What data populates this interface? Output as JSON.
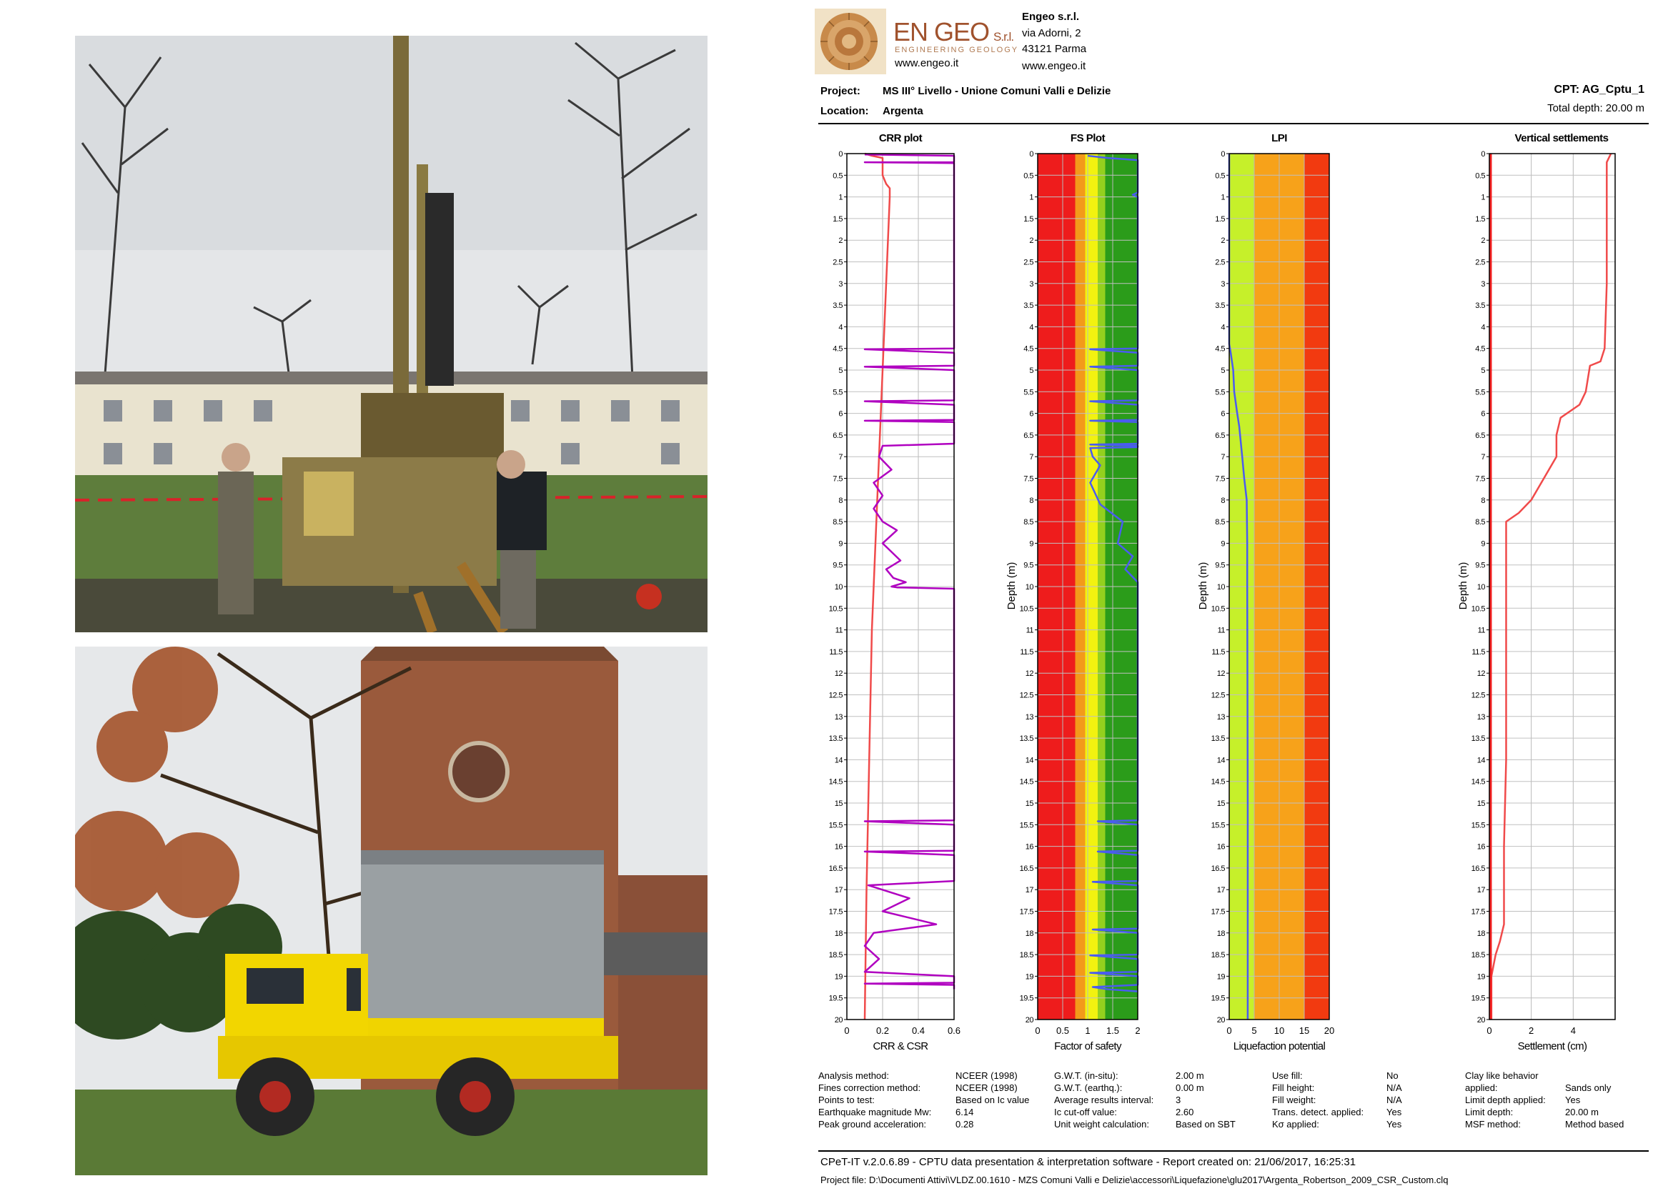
{
  "report": {
    "company": {
      "logo_main": "EN GEO",
      "logo_suffix": "S.r.l.",
      "logo_tagline": "ENGINEERING GEOLOGY",
      "logo_web": "www.engeo.it",
      "name": "Engeo s.r.l.",
      "address1": "via Adorni, 2",
      "address2": "43121 Parma",
      "web": "www.engeo.it"
    },
    "project_label": "Project:",
    "project_value": "MS III° Livello - Unione Comuni Valli e Delizie",
    "location_label": "Location:",
    "location_value": "Argenta",
    "cpt_label": "CPT: AG_Cptu_1",
    "total_depth": "Total depth: 20.00 m",
    "summary": {
      "col1": [
        [
          "Analysis method:",
          "NCEER (1998)"
        ],
        [
          "Fines correction method:",
          "NCEER (1998)"
        ],
        [
          "Points to test:",
          "Based on Ic value"
        ],
        [
          "Earthquake magnitude Mw:",
          "6.14"
        ],
        [
          "Peak ground acceleration:",
          "0.28"
        ]
      ],
      "col2": [
        [
          "G.W.T. (in-situ):",
          "2.00 m"
        ],
        [
          "G.W.T. (earthq.):",
          "0.00 m"
        ],
        [
          "Average results interval:",
          "3"
        ],
        [
          "Ic cut-off value:",
          "2.60"
        ],
        [
          "Unit weight calculation:",
          "Based on SBT"
        ]
      ],
      "col3": [
        [
          "Use fill:",
          "No"
        ],
        [
          "Fill height:",
          "N/A"
        ],
        [
          "Fill weight:",
          "N/A"
        ],
        [
          "Trans. detect. applied:",
          "Yes"
        ],
        [
          "Kσ applied:",
          "Yes"
        ]
      ],
      "col4": [
        [
          "Clay like behavior",
          ""
        ],
        [
          "applied:",
          "Sands only"
        ],
        [
          "Limit depth applied:",
          "Yes"
        ],
        [
          "Limit depth:",
          "20.00 m"
        ],
        [
          "MSF method:",
          "Method based"
        ]
      ]
    },
    "footer1": "CPeT-IT v.2.0.6.89 - CPTU data presentation & interpretation software - Report created on: 21/06/2017, 16:25:31",
    "footer2": "Project file: D:\\Documenti Attivi\\VLDZ.00.1610 - MZS Comuni Valli e Delizie\\accessori\\Liquefazione\\glu2017\\Argenta_Robertson_2009_CSR_Custom.clq"
  },
  "chart_data": [
    {
      "type": "line",
      "title": "CRR plot",
      "xlabel": "CRR & CSR",
      "ylabel": "",
      "xlim": [
        0,
        0.6
      ],
      "ylim": [
        0,
        20
      ],
      "xticks": [
        "0",
        "0.2",
        "0.4",
        "0.6"
      ],
      "yticks": [
        "0",
        "0.5",
        "1",
        "1.5",
        "2",
        "2.5",
        "3",
        "3.5",
        "4",
        "4.5",
        "5",
        "5.5",
        "6",
        "6.5",
        "7",
        "7.5",
        "8",
        "8.5",
        "9",
        "9.5",
        "10",
        "10.5",
        "11",
        "11.5",
        "12",
        "12.5",
        "13",
        "13.5",
        "14",
        "14.5",
        "15",
        "15.5",
        "16",
        "16.5",
        "17",
        "17.5",
        "18",
        "18.5",
        "19",
        "19.5",
        "20"
      ],
      "grid": true,
      "series": [
        {
          "name": "",
          "color": "#f04a4a",
          "x": [
            0.1,
            0.14,
            0.2,
            0.2,
            0.21,
            0.22,
            0.24,
            0.24,
            0.23,
            0.22,
            0.21,
            0.2,
            0.19,
            0.17,
            0.16,
            0.14,
            0.13,
            0.12,
            0.11,
            0.1
          ],
          "depth": [
            0,
            0.05,
            0.1,
            0.5,
            0.6,
            0.7,
            0.8,
            1.0,
            2.0,
            3.0,
            4.0,
            5.0,
            6.0,
            8.0,
            9.0,
            11.0,
            13.0,
            15.0,
            17.0,
            20.0
          ]
        },
        {
          "name": "",
          "color": "#b000c0",
          "x": [
            0.1,
            0.6,
            0.6,
            0.1,
            0.6,
            0.6,
            0.1,
            0.6,
            0.6,
            0.1,
            0.6,
            0.6,
            0.1,
            0.6,
            0.6,
            0.1,
            0.6,
            0.6,
            0.2,
            0.18,
            0.25,
            0.15,
            0.2,
            0.15,
            0.2,
            0.28,
            0.2,
            0.25,
            0.3,
            0.22,
            0.26,
            0.33,
            0.25,
            0.28,
            0.6,
            0.6,
            0.1,
            0.6,
            0.6,
            0.1,
            0.6,
            0.6,
            0.12,
            0.35,
            0.2,
            0.5,
            0.15,
            0.1,
            0.18,
            0.1,
            0.6,
            0.6,
            0.1,
            0.6,
            0.6
          ],
          "depth": [
            0.02,
            0.05,
            0.2,
            0.2,
            0.22,
            4.5,
            4.52,
            4.6,
            4.9,
            4.92,
            5.0,
            5.7,
            5.72,
            5.8,
            6.15,
            6.17,
            6.2,
            6.7,
            6.75,
            7.0,
            7.3,
            7.6,
            7.9,
            8.2,
            8.5,
            8.7,
            9.0,
            9.2,
            9.4,
            9.6,
            9.8,
            9.9,
            10.0,
            10.02,
            10.05,
            15.4,
            15.42,
            15.5,
            16.1,
            16.12,
            16.2,
            16.8,
            16.9,
            17.2,
            17.5,
            17.8,
            18.0,
            18.3,
            18.6,
            18.9,
            19.0,
            19.15,
            19.17,
            19.2,
            19.3
          ]
        }
      ]
    },
    {
      "type": "line",
      "title": "FS Plot",
      "xlabel": "Factor of safety",
      "ylabel": "Depth (m)",
      "xlim": [
        0,
        2
      ],
      "ylim": [
        0,
        20
      ],
      "xticks": [
        "0",
        "0.5",
        "1",
        "1.5",
        "2"
      ],
      "yticks": [
        "0",
        "0.5",
        "1",
        "1.5",
        "2",
        "2.5",
        "3",
        "3.5",
        "4",
        "4.5",
        "5",
        "5.5",
        "6",
        "6.5",
        "7",
        "7.5",
        "8",
        "8.5",
        "9",
        "9.5",
        "10",
        "10.5",
        "11",
        "11.5",
        "12",
        "12.5",
        "13",
        "13.5",
        "14",
        "14.5",
        "15",
        "15.5",
        "16",
        "16.5",
        "17",
        "17.5",
        "18",
        "18.5",
        "19",
        "19.5",
        "20"
      ],
      "grid": true,
      "zones": [
        {
          "x0": 0,
          "x1": 0.75,
          "color": "#ee1c1c"
        },
        {
          "x0": 0.75,
          "x1": 0.95,
          "color": "#f39a1a"
        },
        {
          "x0": 0.95,
          "x1": 1.2,
          "color": "#f2f210"
        },
        {
          "x0": 1.2,
          "x1": 1.35,
          "color": "#94d01e"
        },
        {
          "x0": 1.35,
          "x1": 2,
          "color": "#2b9c1a"
        }
      ],
      "series": [
        {
          "name": "",
          "color": "#4a5cf0",
          "x": [
            1.0,
            1.4,
            2.0,
            2.0,
            1.9,
            2.0,
            2.0,
            1.05,
            2.0,
            2.0,
            1.05,
            2.0,
            2.0,
            1.05,
            2.0,
            2.0,
            1.05,
            2.0,
            2.0,
            1.05,
            2.0,
            2.0,
            1.05,
            1.1,
            1.25,
            1.05,
            1.25,
            1.7,
            1.6,
            1.9,
            1.75,
            2.0,
            2.0,
            1.2,
            2.0,
            2.0,
            1.2,
            2.0,
            2.0,
            1.1,
            2.0,
            2.0,
            1.1,
            2.0,
            2.0,
            1.05,
            2.0,
            2.0,
            1.05,
            2.0,
            2.0,
            1.1,
            1.4,
            2.0
          ],
          "depth": [
            0.05,
            0.1,
            0.15,
            0.9,
            0.95,
            1.0,
            4.5,
            4.52,
            4.6,
            4.9,
            4.92,
            5.0,
            5.7,
            5.72,
            5.8,
            6.15,
            6.17,
            6.2,
            6.7,
            6.72,
            6.75,
            6.78,
            6.8,
            7.0,
            7.2,
            7.6,
            8.1,
            8.5,
            9.0,
            9.3,
            9.6,
            9.9,
            15.4,
            15.42,
            15.5,
            16.1,
            16.12,
            16.2,
            16.8,
            16.82,
            16.9,
            17.9,
            17.92,
            18.0,
            18.5,
            18.52,
            18.6,
            18.9,
            18.92,
            19.0,
            19.2,
            19.25,
            19.3,
            19.35
          ]
        }
      ]
    },
    {
      "type": "line",
      "title": "LPI",
      "xlabel": "Liquefaction potential",
      "ylabel": "Depth (m)",
      "xlim": [
        0,
        20
      ],
      "ylim": [
        0,
        20
      ],
      "xticks": [
        "0",
        "5",
        "10",
        "15",
        "20"
      ],
      "yticks": [
        "0",
        "0.5",
        "1",
        "1.5",
        "2",
        "2.5",
        "3",
        "3.5",
        "4",
        "4.5",
        "5",
        "5.5",
        "6",
        "6.5",
        "7",
        "7.5",
        "8",
        "8.5",
        "9",
        "9.5",
        "10",
        "10.5",
        "11",
        "11.5",
        "12",
        "12.5",
        "13",
        "13.5",
        "14",
        "14.5",
        "15",
        "15.5",
        "16",
        "16.5",
        "17",
        "17.5",
        "18",
        "18.5",
        "19",
        "19.5",
        "20"
      ],
      "grid": true,
      "zones": [
        {
          "x0": 0,
          "x1": 5,
          "color": "#c6f02a"
        },
        {
          "x0": 5,
          "x1": 15,
          "color": "#f7a21a"
        },
        {
          "x0": 15,
          "x1": 20,
          "color": "#f23a10"
        }
      ],
      "series": [
        {
          "name": "",
          "color": "#4a5cf0",
          "x": [
            0,
            0,
            0.3,
            0.8,
            1.0,
            1.6,
            2.0,
            2.6,
            3.0,
            3.5,
            3.6,
            3.6,
            3.7,
            3.7
          ],
          "depth": [
            0,
            4.4,
            4.6,
            5.0,
            5.5,
            6.0,
            6.3,
            7.0,
            7.5,
            8.0,
            9.0,
            10.0,
            15.0,
            20.0
          ]
        }
      ]
    },
    {
      "type": "line",
      "title": "Vertical settlements",
      "xlabel": "Settlement (cm)",
      "ylabel": "Depth (m)",
      "xlim": [
        0,
        6
      ],
      "ylim": [
        0,
        20
      ],
      "xticks": [
        "0",
        "2",
        "4"
      ],
      "yticks": [
        "0",
        "0.5",
        "1",
        "1.5",
        "2",
        "2.5",
        "3",
        "3.5",
        "4",
        "4.5",
        "5",
        "5.5",
        "6",
        "6.5",
        "7",
        "7.5",
        "8",
        "8.5",
        "9",
        "9.5",
        "10",
        "10.5",
        "11",
        "11.5",
        "12",
        "12.5",
        "13",
        "13.5",
        "14",
        "14.5",
        "15",
        "15.5",
        "16",
        "16.5",
        "17",
        "17.5",
        "18",
        "18.5",
        "19",
        "19.5",
        "20"
      ],
      "grid": true,
      "series": [
        {
          "name": "",
          "color": "#f04a4a",
          "x": [
            5.8,
            5.6,
            5.6,
            5.5,
            5.3,
            4.8,
            4.6,
            4.4,
            4.3,
            3.4,
            3.2,
            3.2,
            2.6,
            2.0,
            1.4,
            0.8,
            0.8,
            0.8,
            0.7,
            0.7,
            0.5,
            0.3,
            0.1,
            0.1
          ],
          "depth": [
            0,
            0.2,
            3.0,
            4.5,
            4.8,
            4.9,
            5.5,
            5.7,
            5.8,
            6.1,
            6.5,
            7.0,
            7.5,
            8.0,
            8.3,
            8.5,
            10.0,
            14.0,
            16.0,
            17.8,
            18.2,
            18.5,
            19.0,
            20.0
          ]
        },
        {
          "name": "",
          "color": "#f42020",
          "x": [
            0.05,
            0.05
          ],
          "depth": [
            0,
            20
          ]
        }
      ]
    }
  ]
}
